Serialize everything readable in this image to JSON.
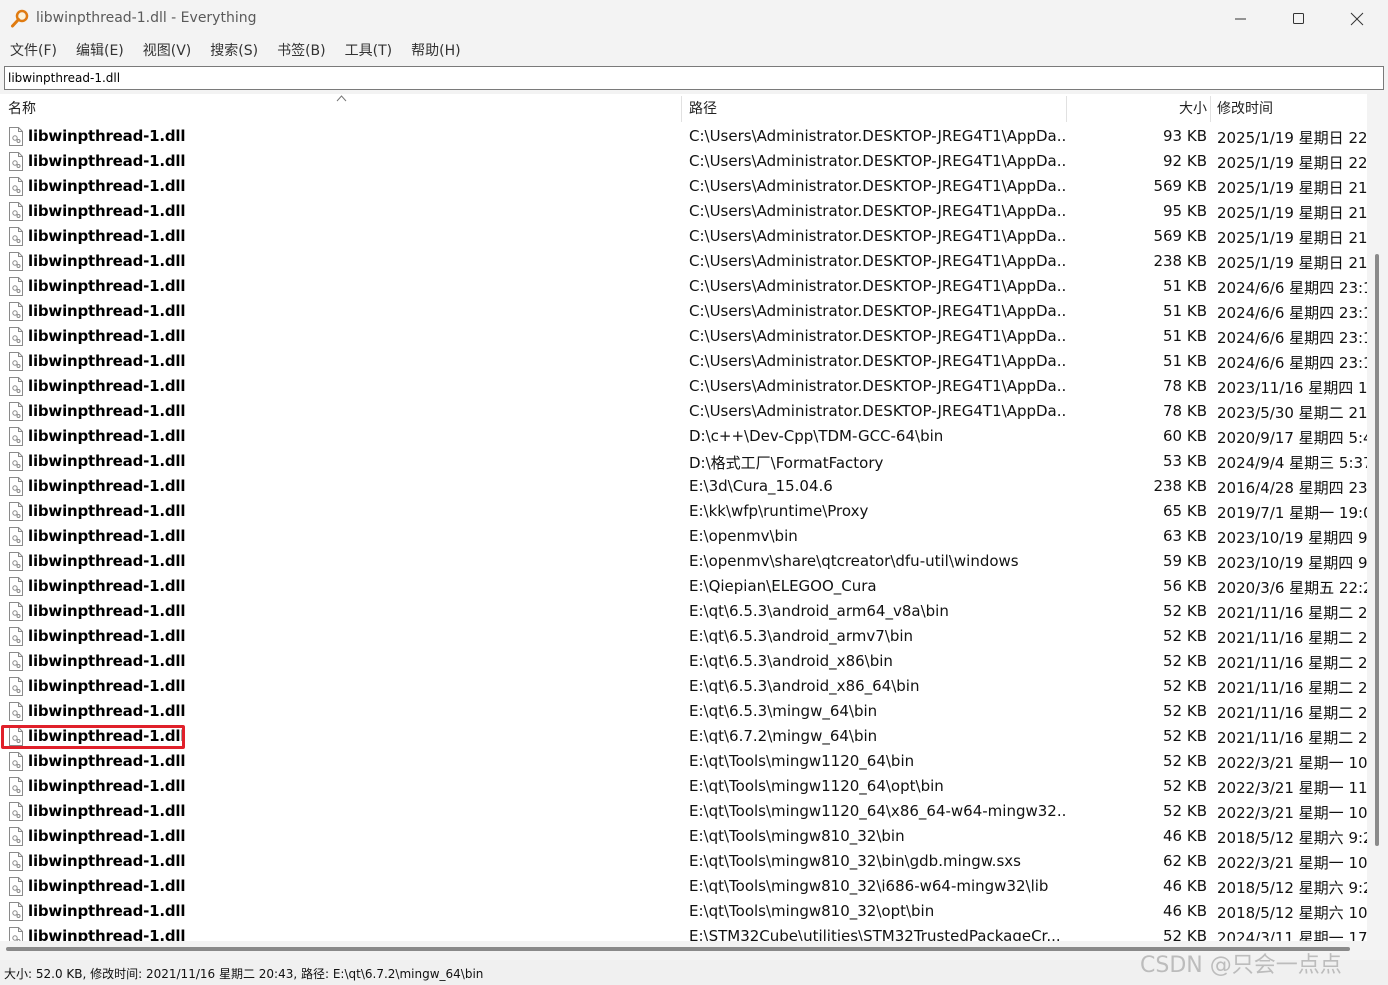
{
  "window": {
    "title": "libwinpthread-1.dll - Everything"
  },
  "menu": [
    "文件(F)",
    "编辑(E)",
    "视图(V)",
    "搜索(S)",
    "书签(B)",
    "工具(T)",
    "帮助(H)"
  ],
  "search": {
    "value": "libwinpthread-1.dll"
  },
  "columns": {
    "name": "名称",
    "path": "路径",
    "size": "大小",
    "modified": "修改时间"
  },
  "rows": [
    {
      "name": "libwinpthread-1.dll",
      "path": "C:\\Users\\Administrator.DESKTOP-JREG4T1\\AppDa...",
      "size": "93 KB",
      "date": "2025/1/19 星期日 22:"
    },
    {
      "name": "libwinpthread-1.dll",
      "path": "C:\\Users\\Administrator.DESKTOP-JREG4T1\\AppDa...",
      "size": "92 KB",
      "date": "2025/1/19 星期日 22:"
    },
    {
      "name": "libwinpthread-1.dll",
      "path": "C:\\Users\\Administrator.DESKTOP-JREG4T1\\AppDa...",
      "size": "569 KB",
      "date": "2025/1/19 星期日 21:"
    },
    {
      "name": "libwinpthread-1.dll",
      "path": "C:\\Users\\Administrator.DESKTOP-JREG4T1\\AppDa...",
      "size": "95 KB",
      "date": "2025/1/19 星期日 21:"
    },
    {
      "name": "libwinpthread-1.dll",
      "path": "C:\\Users\\Administrator.DESKTOP-JREG4T1\\AppDa...",
      "size": "569 KB",
      "date": "2025/1/19 星期日 21:"
    },
    {
      "name": "libwinpthread-1.dll",
      "path": "C:\\Users\\Administrator.DESKTOP-JREG4T1\\AppDa...",
      "size": "238 KB",
      "date": "2025/1/19 星期日 21:"
    },
    {
      "name": "libwinpthread-1.dll",
      "path": "C:\\Users\\Administrator.DESKTOP-JREG4T1\\AppDa...",
      "size": "51 KB",
      "date": "2024/6/6 星期四 23:1"
    },
    {
      "name": "libwinpthread-1.dll",
      "path": "C:\\Users\\Administrator.DESKTOP-JREG4T1\\AppDa...",
      "size": "51 KB",
      "date": "2024/6/6 星期四 23:1"
    },
    {
      "name": "libwinpthread-1.dll",
      "path": "C:\\Users\\Administrator.DESKTOP-JREG4T1\\AppDa...",
      "size": "51 KB",
      "date": "2024/6/6 星期四 23:1"
    },
    {
      "name": "libwinpthread-1.dll",
      "path": "C:\\Users\\Administrator.DESKTOP-JREG4T1\\AppDa...",
      "size": "51 KB",
      "date": "2024/6/6 星期四 23:1"
    },
    {
      "name": "libwinpthread-1.dll",
      "path": "C:\\Users\\Administrator.DESKTOP-JREG4T1\\AppDa...",
      "size": "78 KB",
      "date": "2023/11/16 星期四 1!"
    },
    {
      "name": "libwinpthread-1.dll",
      "path": "C:\\Users\\Administrator.DESKTOP-JREG4T1\\AppDa...",
      "size": "78 KB",
      "date": "2023/5/30 星期二 21:"
    },
    {
      "name": "libwinpthread-1.dll",
      "path": "D:\\c++\\Dev-Cpp\\TDM-GCC-64\\bin",
      "size": "60 KB",
      "date": "2020/9/17 星期四 5:4"
    },
    {
      "name": "libwinpthread-1.dll",
      "path": "D:\\格式工厂\\FormatFactory",
      "size": "53 KB",
      "date": "2024/9/4 星期三 5:37"
    },
    {
      "name": "libwinpthread-1.dll",
      "path": "E:\\3d\\Cura_15.04.6",
      "size": "238 KB",
      "date": "2016/4/28 星期四 23:"
    },
    {
      "name": "libwinpthread-1.dll",
      "path": "E:\\kk\\wfp\\runtime\\Proxy",
      "size": "65 KB",
      "date": "2019/7/1 星期一 19:0"
    },
    {
      "name": "libwinpthread-1.dll",
      "path": "E:\\openmv\\bin",
      "size": "63 KB",
      "date": "2023/10/19 星期四 9:"
    },
    {
      "name": "libwinpthread-1.dll",
      "path": "E:\\openmv\\share\\qtcreator\\dfu-util\\windows",
      "size": "59 KB",
      "date": "2023/10/19 星期四 9:"
    },
    {
      "name": "libwinpthread-1.dll",
      "path": "E:\\Qiepian\\ELEGOO_Cura",
      "size": "56 KB",
      "date": "2020/3/6 星期五 22:2"
    },
    {
      "name": "libwinpthread-1.dll",
      "path": "E:\\qt\\6.5.3\\android_arm64_v8a\\bin",
      "size": "52 KB",
      "date": "2021/11/16 星期二 2("
    },
    {
      "name": "libwinpthread-1.dll",
      "path": "E:\\qt\\6.5.3\\android_armv7\\bin",
      "size": "52 KB",
      "date": "2021/11/16 星期二 2("
    },
    {
      "name": "libwinpthread-1.dll",
      "path": "E:\\qt\\6.5.3\\android_x86\\bin",
      "size": "52 KB",
      "date": "2021/11/16 星期二 2("
    },
    {
      "name": "libwinpthread-1.dll",
      "path": "E:\\qt\\6.5.3\\android_x86_64\\bin",
      "size": "52 KB",
      "date": "2021/11/16 星期二 2("
    },
    {
      "name": "libwinpthread-1.dll",
      "path": "E:\\qt\\6.5.3\\mingw_64\\bin",
      "size": "52 KB",
      "date": "2021/11/16 星期二 2("
    },
    {
      "name": "libwinpthread-1.dll",
      "path": "E:\\qt\\6.7.2\\mingw_64\\bin",
      "size": "52 KB",
      "date": "2021/11/16 星期二 2("
    },
    {
      "name": "libwinpthread-1.dll",
      "path": "E:\\qt\\Tools\\mingw1120_64\\bin",
      "size": "52 KB",
      "date": "2022/3/21 星期一 10:"
    },
    {
      "name": "libwinpthread-1.dll",
      "path": "E:\\qt\\Tools\\mingw1120_64\\opt\\bin",
      "size": "52 KB",
      "date": "2022/3/21 星期一 11:"
    },
    {
      "name": "libwinpthread-1.dll",
      "path": "E:\\qt\\Tools\\mingw1120_64\\x86_64-w64-mingw32...",
      "size": "52 KB",
      "date": "2022/3/21 星期一 10:"
    },
    {
      "name": "libwinpthread-1.dll",
      "path": "E:\\qt\\Tools\\mingw810_32\\bin",
      "size": "46 KB",
      "date": "2018/5/12 星期六 9:2"
    },
    {
      "name": "libwinpthread-1.dll",
      "path": "E:\\qt\\Tools\\mingw810_32\\bin\\gdb.mingw.sxs",
      "size": "62 KB",
      "date": "2022/3/21 星期一 10:"
    },
    {
      "name": "libwinpthread-1.dll",
      "path": "E:\\qt\\Tools\\mingw810_32\\i686-w64-mingw32\\lib",
      "size": "46 KB",
      "date": "2018/5/12 星期六 9:2"
    },
    {
      "name": "libwinpthread-1.dll",
      "path": "E:\\qt\\Tools\\mingw810_32\\opt\\bin",
      "size": "46 KB",
      "date": "2018/5/12 星期六 10:"
    },
    {
      "name": "libwinpthread-1.dll",
      "path": "E:\\STM32Cube\\utilities\\STM32TrustedPackageCr...",
      "size": "52 KB",
      "date": "2024/3/11 星期一 17:"
    }
  ],
  "status": {
    "text": "大小: 52.0 KB, 修改时间: 2021/11/16 星期二 20:43, 路径: E:\\qt\\6.7.2\\mingw_64\\bin"
  },
  "watermark": "CSDN @只会一点点",
  "colors": {
    "highlight": "#e0202a",
    "background": "#f3f3f3"
  }
}
